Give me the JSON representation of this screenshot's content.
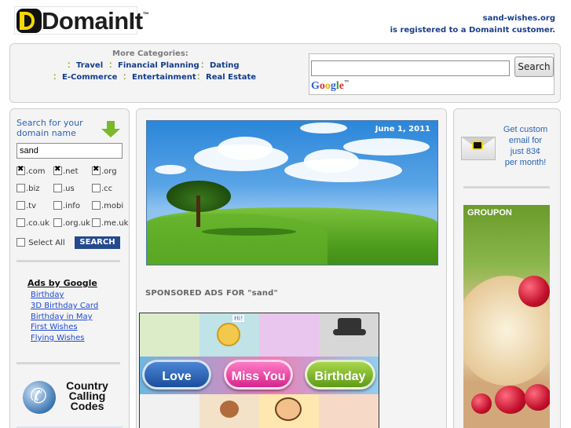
{
  "header": {
    "logo_text": "DomainIt",
    "logo_tm": "™",
    "registration_line1": "sand-wishes.org",
    "registration_line2": "is registered to a DomainIt customer."
  },
  "categories": {
    "label": "More Categories:",
    "items": [
      "Travel",
      "Financial Planning",
      "Dating",
      "E-Commerce",
      "Entertainment",
      "Real Estate"
    ]
  },
  "google_search": {
    "input_value": "",
    "button_label": "Search",
    "brand": "Google",
    "brand_tm": "™"
  },
  "domain_search": {
    "title_line1": "Search for your",
    "title_line2": "domain name",
    "input_value": "sand",
    "tlds": [
      {
        "label": ".com",
        "checked": true
      },
      {
        "label": ".net",
        "checked": true
      },
      {
        "label": ".org",
        "checked": true
      },
      {
        "label": ".biz",
        "checked": false
      },
      {
        "label": ".us",
        "checked": false
      },
      {
        "label": ".cc",
        "checked": false
      },
      {
        "label": ".tv",
        "checked": false
      },
      {
        "label": ".info",
        "checked": false
      },
      {
        "label": ".mobi",
        "checked": false
      },
      {
        "label": ".co.uk",
        "checked": false
      },
      {
        "label": ".org.uk",
        "checked": false
      },
      {
        "label": ".me.uk",
        "checked": false
      }
    ],
    "select_all_label": "Select All",
    "search_button": "SEARCH"
  },
  "ads": {
    "title": "Ads by Google",
    "links": [
      "Birthday",
      "3D Birthday Card",
      "Birthday in May",
      "First Wishes",
      "Flying Wishes"
    ]
  },
  "country_codes": {
    "line1": "Country",
    "line2": "Calling",
    "line3": "Codes"
  },
  "hero": {
    "date": "June 1, 2011"
  },
  "sponsored": {
    "heading": "SPONSORED ADS FOR \"sand\""
  },
  "ecard": {
    "pills": [
      "Love",
      "Miss You",
      "Birthday"
    ],
    "hi_label": "Hi!"
  },
  "right_promo": {
    "line1": "Get custom",
    "line2": "email for",
    "line3": "just 83¢",
    "line4": "per month!"
  },
  "groupon": {
    "label": "GROUPON"
  },
  "colors": {
    "brand_blue": "#1b3f8b",
    "link_blue": "#1f4ad1",
    "accent_green": "#79b92b",
    "logo_yellow": "#f5d800"
  }
}
